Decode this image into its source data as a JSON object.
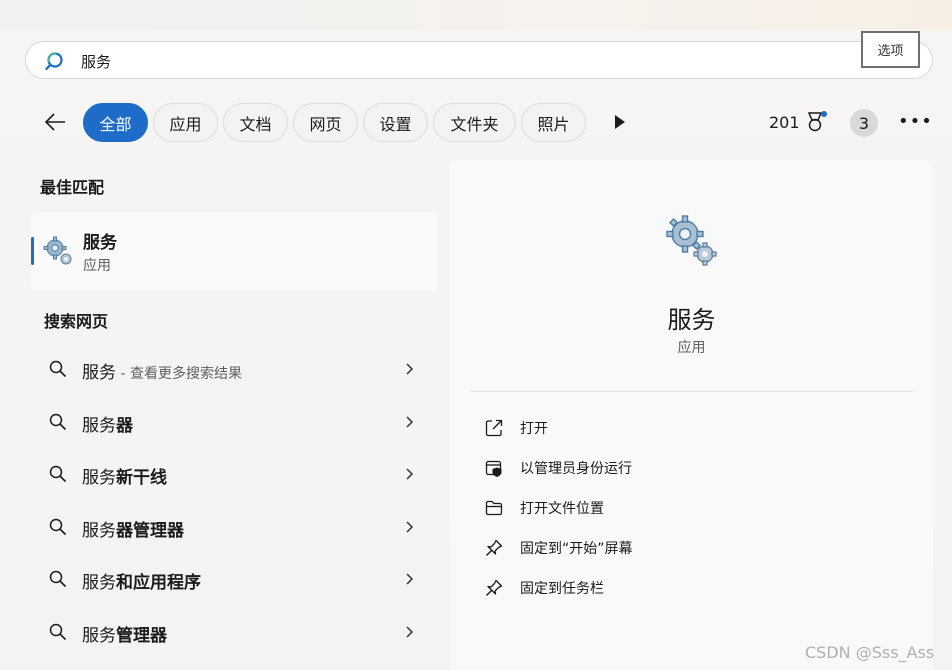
{
  "search": {
    "query": "服务"
  },
  "options_button": "选项",
  "filters": [
    "全部",
    "应用",
    "文档",
    "网页",
    "设置",
    "文件夹",
    "照片"
  ],
  "rewards": {
    "points": "201",
    "count": "3"
  },
  "best_match": {
    "title": "最佳匹配",
    "item": {
      "name": "服务",
      "type": "应用"
    }
  },
  "web_search": {
    "title": "搜索网页",
    "results": [
      {
        "prefix": "服务",
        "bold": "",
        "suffix": " - 查看更多搜索结果"
      },
      {
        "prefix": "服务",
        "bold": "器",
        "suffix": ""
      },
      {
        "prefix": "服务",
        "bold": "新干线",
        "suffix": ""
      },
      {
        "prefix": "服务",
        "bold": "器管理器",
        "suffix": ""
      },
      {
        "prefix": "服务",
        "bold": "和应用程序",
        "suffix": ""
      },
      {
        "prefix": "服务",
        "bold": "管理器",
        "suffix": ""
      }
    ]
  },
  "detail": {
    "name": "服务",
    "type": "应用",
    "actions": [
      {
        "label": "打开",
        "icon": "open-external-icon"
      },
      {
        "label": "以管理员身份运行",
        "icon": "shield-admin-icon"
      },
      {
        "label": "打开文件位置",
        "icon": "folder-icon"
      },
      {
        "label": "固定到“开始”屏幕",
        "icon": "pin-icon"
      },
      {
        "label": "固定到任务栏",
        "icon": "pin-icon"
      }
    ]
  },
  "watermark": "CSDN @Sss_Ass",
  "colors": {
    "accent": "#1f6cc8"
  }
}
